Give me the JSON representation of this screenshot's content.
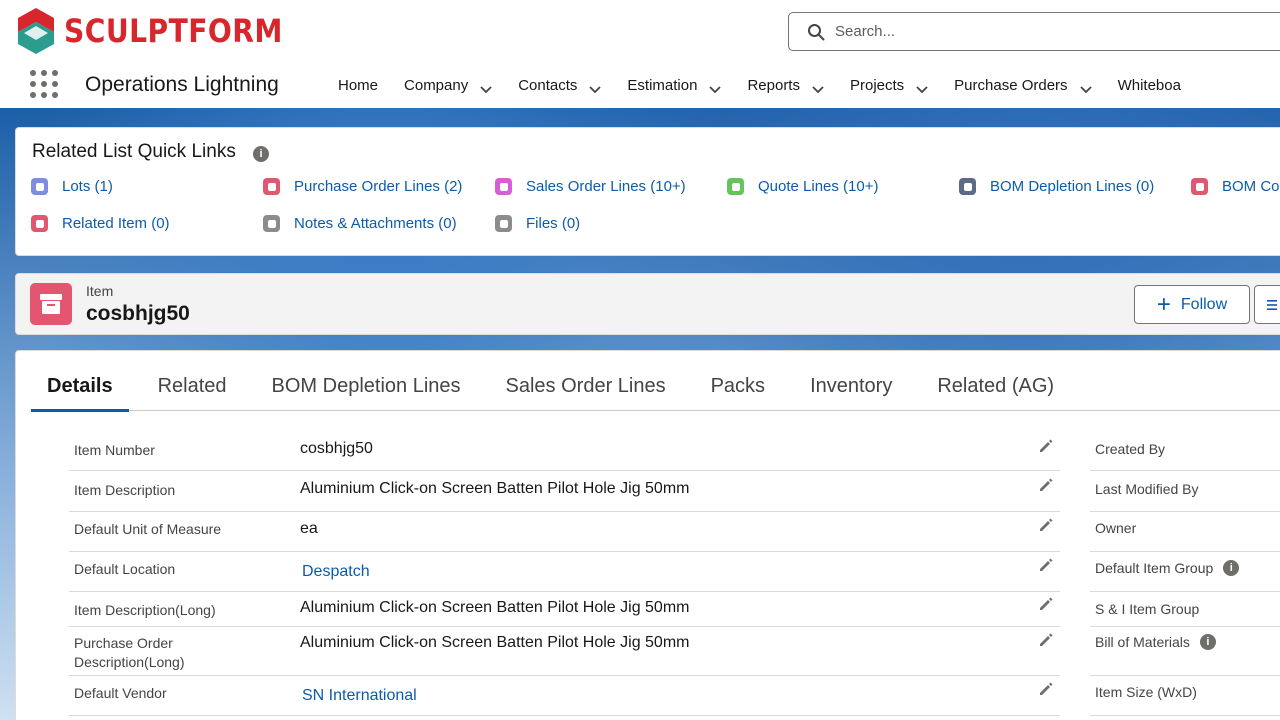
{
  "brand": {
    "name": "SCULPTFORM",
    "color": "#d7262c"
  },
  "search": {
    "placeholder": "Search..."
  },
  "app": {
    "name": "Operations Lightning"
  },
  "nav": [
    {
      "label": "Home",
      "dropdown": false
    },
    {
      "label": "Company",
      "dropdown": true
    },
    {
      "label": "Contacts",
      "dropdown": true
    },
    {
      "label": "Estimation",
      "dropdown": true
    },
    {
      "label": "Reports",
      "dropdown": true
    },
    {
      "label": "Projects",
      "dropdown": true
    },
    {
      "label": "Purchase Orders",
      "dropdown": true
    },
    {
      "label": "Whiteboa",
      "dropdown": false
    }
  ],
  "quick_links": {
    "title": "Related List Quick Links",
    "items": [
      {
        "label": "Lots (1)",
        "icon": "lots-icon",
        "color": "#7f8de1"
      },
      {
        "label": "Purchase Order Lines (2)",
        "icon": "purchase-order-icon",
        "color": "#e3566f"
      },
      {
        "label": "Sales Order Lines (10+)",
        "icon": "sales-order-icon",
        "color": "#d55fd6"
      },
      {
        "label": "Quote Lines (10+)",
        "icon": "quote-icon",
        "color": "#62c45b"
      },
      {
        "label": "BOM Depletion Lines (0)",
        "icon": "wrench-icon",
        "color": "#5c6b85"
      },
      {
        "label": "BOM Co",
        "icon": "bom-icon",
        "color": "#e3566f"
      },
      {
        "label": "Related Item (0)",
        "icon": "related-item-icon",
        "color": "#e3566f"
      },
      {
        "label": "Notes & Attachments (0)",
        "icon": "notes-icon",
        "color": "#8c8c8c"
      },
      {
        "label": "Files (0)",
        "icon": "files-icon",
        "color": "#8c8c8c"
      }
    ]
  },
  "record": {
    "object_label": "Item",
    "name": "cosbhjg50",
    "follow_label": "Follow",
    "icon_color": "#e3566f"
  },
  "tabs": [
    {
      "label": "Details",
      "active": true
    },
    {
      "label": "Related",
      "active": false
    },
    {
      "label": "BOM Depletion Lines",
      "active": false
    },
    {
      "label": "Sales Order Lines",
      "active": false
    },
    {
      "label": "Packs",
      "active": false
    },
    {
      "label": "Inventory",
      "active": false
    },
    {
      "label": "Related (AG)",
      "active": false
    }
  ],
  "fields": [
    {
      "label": "Item Number",
      "value": "cosbhjg50",
      "link": false
    },
    {
      "label": "Item Description",
      "value": "Aluminium Click-on Screen Batten Pilot Hole Jig 50mm",
      "link": false
    },
    {
      "label": "Default Unit of Measure",
      "value": "ea",
      "link": false
    },
    {
      "label": "Default Location",
      "value": "Despatch",
      "link": true
    },
    {
      "label": "Item Description(Long)",
      "value": "Aluminium Click-on Screen Batten Pilot Hole Jig 50mm",
      "link": false
    },
    {
      "label": "Purchase Order Description(Long)",
      "value": "Aluminium Click-on Screen Batten Pilot Hole Jig 50mm",
      "link": false
    },
    {
      "label": "Default Vendor",
      "value": "SN International",
      "link": true
    }
  ],
  "right_fields": [
    {
      "label": "Created By",
      "info": false
    },
    {
      "label": "Last Modified By",
      "info": false
    },
    {
      "label": "Owner",
      "info": false
    },
    {
      "label": "Default Item Group",
      "info": true
    },
    {
      "label": "S & I Item Group",
      "info": false
    },
    {
      "label": "Bill of Materials",
      "info": true
    },
    {
      "label": "Item Size (WxD)",
      "info": false
    }
  ]
}
